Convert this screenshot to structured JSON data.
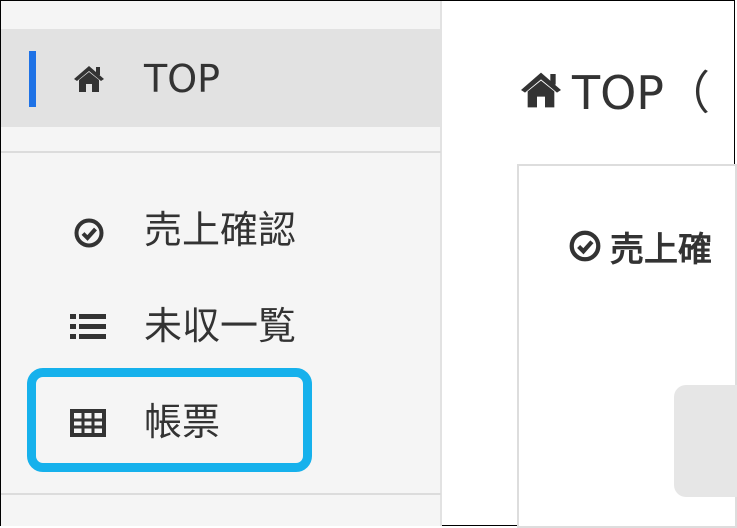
{
  "sidebar": {
    "items": [
      {
        "label": "TOP",
        "icon": "home-icon",
        "active": true
      },
      {
        "label": "売上確認",
        "icon": "check-circle-icon"
      },
      {
        "label": "未収一覧",
        "icon": "list-icon"
      },
      {
        "label": "帳票",
        "icon": "table-icon",
        "highlighted": true
      }
    ]
  },
  "main": {
    "title": "TOP（",
    "card_title": "売上確"
  },
  "colors": {
    "accent": "#1e72e6",
    "highlight": "#16b1ec",
    "sidebar_bg": "#f5f5f5",
    "active_bg": "#e2e2e2"
  }
}
